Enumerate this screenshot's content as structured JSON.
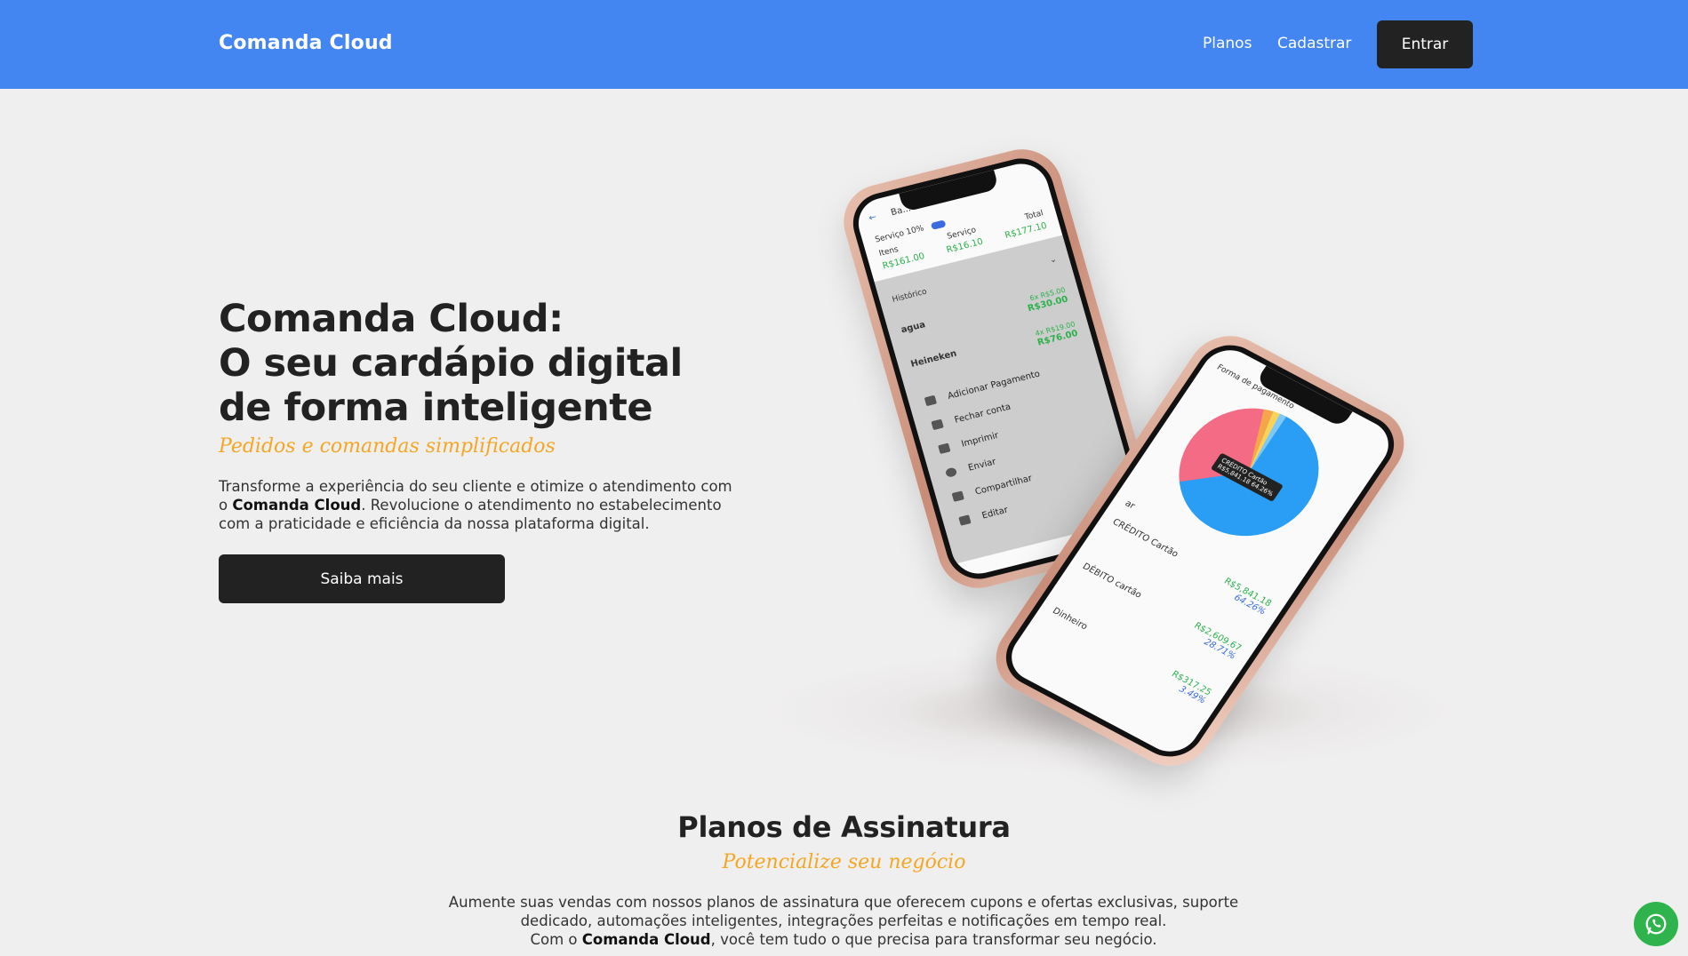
{
  "header": {
    "brand": "Comanda Cloud",
    "nav": {
      "planos": "Planos",
      "cadastrar": "Cadastrar"
    },
    "login_button": "Entrar",
    "color": "#4386f2"
  },
  "hero": {
    "title_lines": [
      "Comanda Cloud:",
      "O seu cardápio digital",
      "de forma inteligente"
    ],
    "tagline": "Pedidos e comandas simplificados",
    "description_pre": "Transforme a experiência do seu cliente e otimize o atendimento com o ",
    "description_bold": "Comanda Cloud",
    "description_post": ". Revolucione o atendimento no estabelecimento com a praticidade e eficiência da nossa plataforma digital.",
    "cta_button": "Saiba mais"
  },
  "phone_left": {
    "header": "Ba...",
    "service_label": "Serviço 10%",
    "cols": [
      "Itens",
      "Serviço",
      "Total"
    ],
    "totals": [
      "R$161.00",
      "R$16.10",
      "R$177.10"
    ],
    "history_label": "Histórico",
    "items": [
      {
        "name": "agua",
        "qty": "6x R$5.00",
        "total": "R$30.00"
      },
      {
        "name": "Heineken",
        "qty": "4x R$19.00",
        "total": "R$76.00"
      }
    ],
    "menu": [
      "Adicionar Pagamento",
      "Fechar conta",
      "Imprimir",
      "Enviar",
      "Compartilhar",
      "Editar"
    ]
  },
  "phone_right": {
    "header": "Forma de pagamento",
    "tooltip_title": "CRÉDITO Cartão",
    "tooltip_value": "R$5,841.18 64.26%",
    "partial_label": "ar",
    "rows": [
      {
        "name": "CRÉDITO Cartão",
        "value": "R$5,841.18",
        "pct": "64.26%"
      },
      {
        "name": "DÉBITO cartão",
        "value": "R$2,609.67",
        "pct": "28.71%"
      },
      {
        "name": "Dinheiro",
        "value": "R$317.25",
        "pct": "3.49%"
      }
    ]
  },
  "plans": {
    "title": "Planos de Assinatura",
    "tagline": "Potencialize seu negócio",
    "desc_line1": "Aumente suas vendas com nossos planos de assinatura que oferecem cupons e ofertas exclusivas, suporte",
    "desc_line2": "dedicado, automações inteligentes, integrações perfeitas e notificações em tempo real.",
    "desc_line3_pre": "Com o ",
    "desc_line3_bold": "Comanda Cloud",
    "desc_line3_post": ", você tem tudo o que precisa para transformar seu negócio."
  },
  "colors": {
    "accent": "#f5a623",
    "dark_button": "#222222",
    "whatsapp": "#2fb34c"
  },
  "icons": {
    "whatsapp": "whatsapp-icon"
  }
}
